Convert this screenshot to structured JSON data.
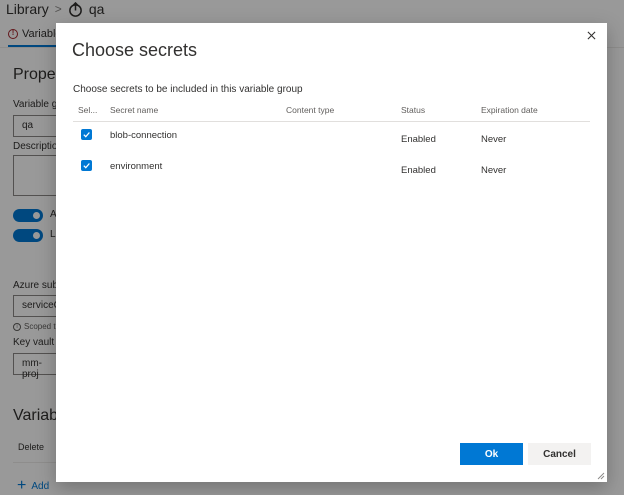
{
  "breadcrumb": {
    "root": "Library",
    "separator": ">",
    "current": "qa"
  },
  "tab": {
    "label": "Variable"
  },
  "properties": {
    "title": "Propert",
    "name_label": "Variable g",
    "name_value": "qa",
    "description_label": "Descriptio",
    "toggle1_label": "A",
    "toggle2_label": "L",
    "azure_label": "Azure sub",
    "azure_value": "serviceC",
    "scoped_text": "Scoped to",
    "keyvault_label": "Key vault",
    "keyvault_value": "mm-proj"
  },
  "variables": {
    "title": "Variable",
    "delete_label": "Delete",
    "add_label": "Add"
  },
  "dialog": {
    "title": "Choose secrets",
    "subtitle": "Choose secrets to be included in this variable group",
    "columns": {
      "select": "Sel...",
      "name": "Secret name",
      "content_type": "Content type",
      "status": "Status",
      "expiration": "Expiration date"
    },
    "rows": [
      {
        "name": "blob-connection",
        "content_type": "",
        "status": "Enabled",
        "expiration": "Never",
        "selected": true
      },
      {
        "name": "environment",
        "content_type": "",
        "status": "Enabled",
        "expiration": "Never",
        "selected": true
      }
    ],
    "ok_label": "Ok",
    "cancel_label": "Cancel"
  },
  "colors": {
    "accent": "#0078d4",
    "overlay": "rgba(0,0,0,0.40)"
  },
  "icons": [
    "pipeline-icon",
    "error-icon",
    "info-icon",
    "plus-icon",
    "close-icon",
    "checkmark-icon",
    "resize-grip-icon"
  ]
}
